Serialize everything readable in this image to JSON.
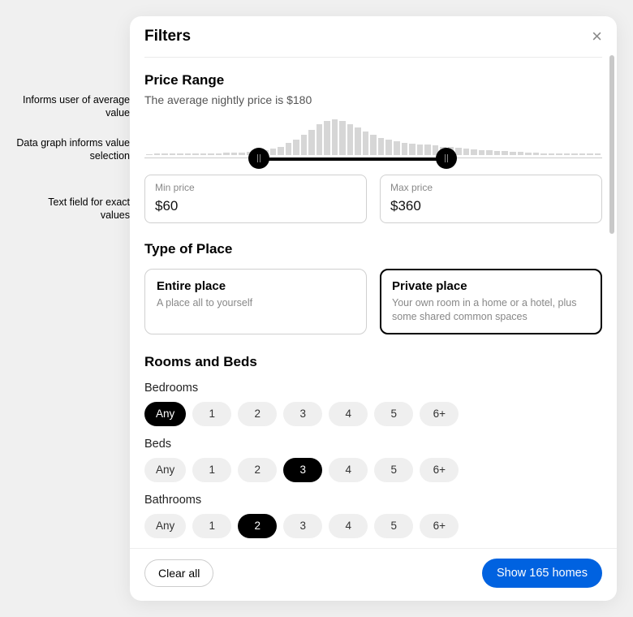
{
  "annotations": {
    "avg": "Informs user of average value",
    "graph": "Data graph informs value selection",
    "text": "Text field for exact values"
  },
  "modal": {
    "title": "Filters",
    "footer": {
      "clear": "Clear all",
      "show": "Show 165 homes"
    }
  },
  "price": {
    "heading": "Price Range",
    "subtitle": "The average nightly price is $180",
    "min_label": "Min price",
    "max_label": "Max price",
    "min_value": "$60",
    "max_value": "$360",
    "slider": {
      "start_pct": 25,
      "end_pct": 66
    },
    "histogram": [
      1,
      2,
      2,
      2,
      2,
      2,
      2,
      2,
      2,
      2,
      3,
      3,
      3,
      4,
      5,
      6,
      8,
      10,
      14,
      18,
      24,
      30,
      36,
      40,
      42,
      40,
      36,
      32,
      28,
      24,
      20,
      18,
      16,
      14,
      13,
      12,
      12,
      11,
      10,
      10,
      9,
      8,
      7,
      6,
      6,
      5,
      5,
      4,
      4,
      3,
      3,
      2,
      2,
      2,
      2,
      2,
      2,
      2,
      2
    ]
  },
  "type_of_place": {
    "heading": "Type of Place",
    "options": [
      {
        "title": "Entire place",
        "desc": "A place all to yourself",
        "selected": false
      },
      {
        "title": "Private place",
        "desc": "Your own room in a home or a hotel, plus some shared common spaces",
        "selected": true
      }
    ]
  },
  "rooms": {
    "heading": "Rooms and Beds",
    "groups": [
      {
        "label": "Bedrooms",
        "options": [
          "Any",
          "1",
          "2",
          "3",
          "4",
          "5",
          "6+"
        ],
        "selected": "Any"
      },
      {
        "label": "Beds",
        "options": [
          "Any",
          "1",
          "2",
          "3",
          "4",
          "5",
          "6+"
        ],
        "selected": "3"
      },
      {
        "label": "Bathrooms",
        "options": [
          "Any",
          "1",
          "2",
          "3",
          "4",
          "5",
          "6+"
        ],
        "selected": "2"
      }
    ]
  }
}
